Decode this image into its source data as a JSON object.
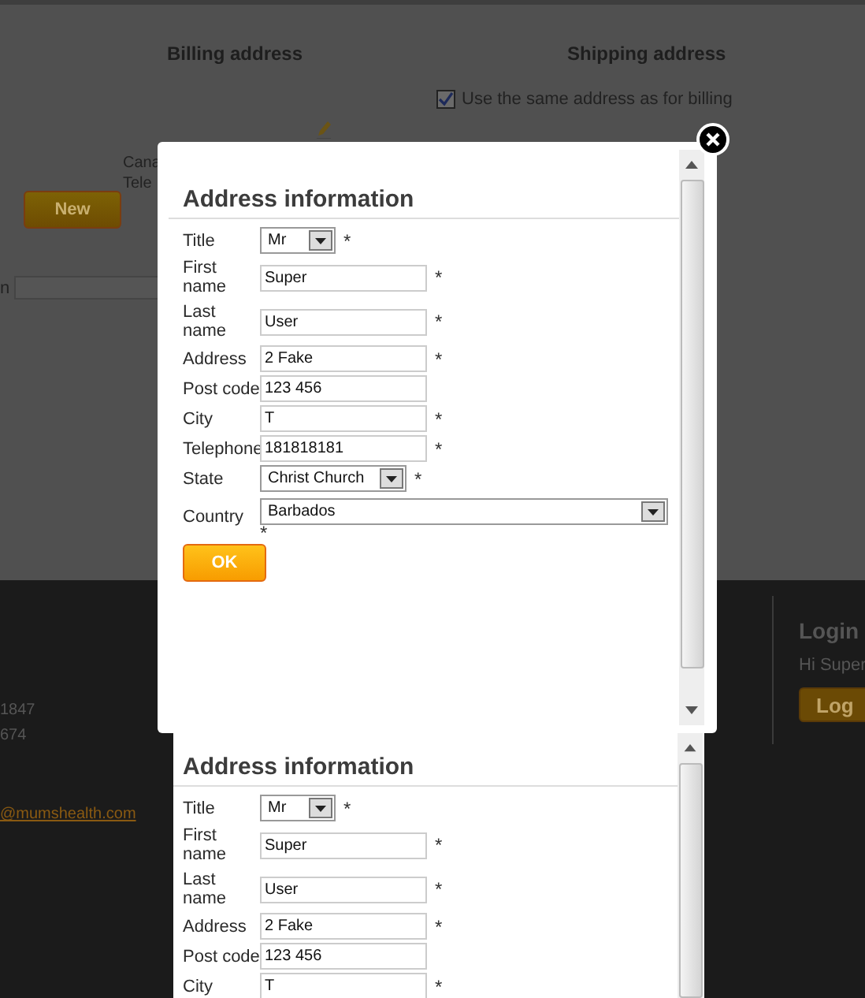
{
  "page": {
    "billing_heading": "Billing address",
    "shipping_heading": "Shipping address",
    "same_address": {
      "label": "Use the same address as for billing",
      "checked": true
    },
    "address_lines": [
      "Cana",
      "Tele"
    ],
    "new_button": "New",
    "search_label": "n"
  },
  "footer": {
    "contact_lines": [
      "1847",
      "674"
    ],
    "email": "@mumshealth.com",
    "login": {
      "title": "Login",
      "greeting": "Hi Super",
      "button": "Log"
    }
  },
  "dialogs": [
    {
      "title": "Address information",
      "fields": [
        {
          "label": "Title",
          "kind": "short-select",
          "value": "Mr",
          "mark": "*"
        },
        {
          "label": "First name",
          "kind": "text",
          "value": "Super",
          "mark": "*"
        },
        {
          "label": "Last name",
          "kind": "text",
          "value": "User",
          "mark": "*"
        },
        {
          "label": "Address",
          "kind": "text",
          "value": "2 Fake",
          "mark": "*"
        },
        {
          "label": "Post code",
          "kind": "text",
          "value": "123 456"
        },
        {
          "label": "City",
          "kind": "text",
          "value": "T",
          "mark": "*"
        },
        {
          "label": "Telephone",
          "kind": "text",
          "value": "181818181",
          "mark": "*"
        },
        {
          "label": "State",
          "kind": "select",
          "value": "Christ Church",
          "mark": "*"
        },
        {
          "label": "Country",
          "kind": "wide-select",
          "value": "Barbados",
          "mark": "*"
        }
      ],
      "button": "OK"
    },
    {
      "title": "Address information",
      "fields": [
        {
          "label": "Title",
          "kind": "short-select",
          "value": "Mr",
          "mark": "*"
        },
        {
          "label": "First name",
          "kind": "text",
          "value": "Super",
          "mark": "*"
        },
        {
          "label": "Last name",
          "kind": "text",
          "value": "User",
          "mark": "*"
        },
        {
          "label": "Address",
          "kind": "text",
          "value": "2 Fake",
          "mark": "*"
        },
        {
          "label": "Post code",
          "kind": "text",
          "value": "123 456"
        },
        {
          "label": "City",
          "kind": "text",
          "value": "T",
          "mark": "*"
        }
      ]
    }
  ]
}
